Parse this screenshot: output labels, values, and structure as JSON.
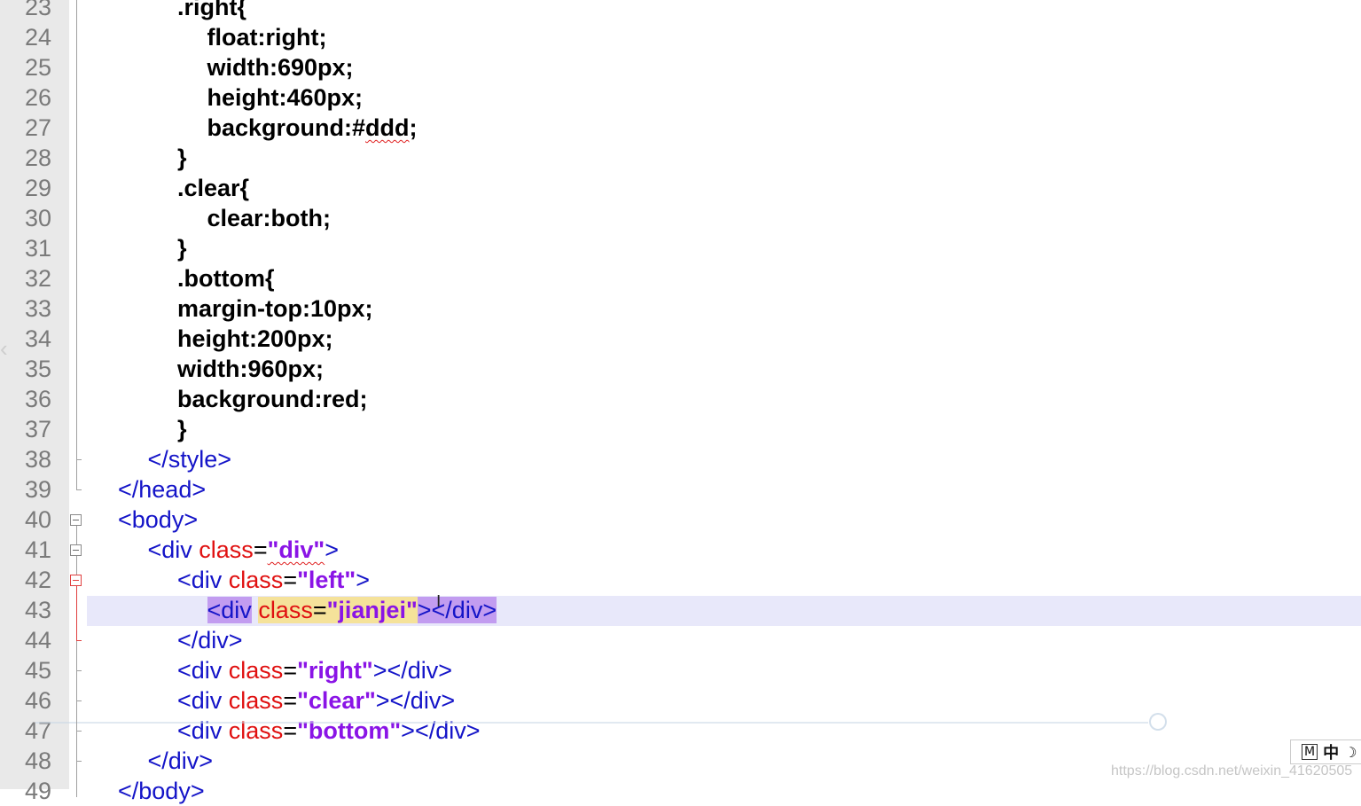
{
  "editor": {
    "lines": [
      {
        "n": "23",
        "indent": 6,
        "tokens": [
          {
            "t": "css",
            "v": ".right{"
          }
        ]
      },
      {
        "n": "24",
        "indent": 7,
        "tokens": [
          {
            "t": "css",
            "v": "float:right;"
          }
        ]
      },
      {
        "n": "25",
        "indent": 7,
        "tokens": [
          {
            "t": "css",
            "v": "width:690px;"
          }
        ]
      },
      {
        "n": "26",
        "indent": 7,
        "tokens": [
          {
            "t": "css",
            "v": "height:460px;"
          }
        ]
      },
      {
        "n": "27",
        "indent": 7,
        "tokens": [
          {
            "t": "css",
            "v": "background:#"
          },
          {
            "t": "css",
            "v": "ddd",
            "squig": true
          },
          {
            "t": "css",
            "v": ";"
          }
        ]
      },
      {
        "n": "28",
        "indent": 6,
        "tokens": [
          {
            "t": "css",
            "v": "}"
          }
        ]
      },
      {
        "n": "29",
        "indent": 6,
        "tokens": [
          {
            "t": "css",
            "v": ".clear{"
          }
        ]
      },
      {
        "n": "30",
        "indent": 7,
        "tokens": [
          {
            "t": "css",
            "v": "clear:both;"
          }
        ]
      },
      {
        "n": "31",
        "indent": 6,
        "tokens": [
          {
            "t": "css",
            "v": "}"
          }
        ]
      },
      {
        "n": "32",
        "indent": 6,
        "tokens": [
          {
            "t": "css",
            "v": ".bottom{"
          }
        ]
      },
      {
        "n": "33",
        "indent": 6,
        "tokens": [
          {
            "t": "css",
            "v": "margin-top:10px;"
          }
        ]
      },
      {
        "n": "34",
        "indent": 6,
        "tokens": [
          {
            "t": "css",
            "v": "height:200px;"
          }
        ]
      },
      {
        "n": "35",
        "indent": 6,
        "tokens": [
          {
            "t": "css",
            "v": "width:960px;"
          }
        ]
      },
      {
        "n": "36",
        "indent": 6,
        "tokens": [
          {
            "t": "css",
            "v": "background:red;"
          }
        ]
      },
      {
        "n": "37",
        "indent": 6,
        "tokens": [
          {
            "t": "css",
            "v": "}"
          }
        ]
      },
      {
        "n": "38",
        "indent": 5,
        "tokens": [
          {
            "t": "tag",
            "v": "</style>"
          }
        ]
      },
      {
        "n": "39",
        "indent": 4,
        "tokens": [
          {
            "t": "tag",
            "v": "</head>"
          }
        ]
      },
      {
        "n": "40",
        "indent": 4,
        "tokens": [
          {
            "t": "tag",
            "v": "<body>"
          }
        ]
      },
      {
        "n": "41",
        "indent": 5,
        "tokens": [
          {
            "t": "tag",
            "v": "<div "
          },
          {
            "t": "attr",
            "v": "class"
          },
          {
            "t": "eq",
            "v": "="
          },
          {
            "t": "val",
            "v": "\"div\"",
            "squig": true
          },
          {
            "t": "tag",
            "v": ">"
          }
        ]
      },
      {
        "n": "42",
        "indent": 6,
        "tokens": [
          {
            "t": "tag",
            "v": "<div "
          },
          {
            "t": "attr",
            "v": "class"
          },
          {
            "t": "eq",
            "v": "="
          },
          {
            "t": "val",
            "v": "\"left\""
          },
          {
            "t": "tag",
            "v": ">"
          }
        ]
      },
      {
        "n": "43",
        "indent": 7,
        "current": true,
        "tokens": [
          {
            "t": "tag",
            "v": "<div",
            "hl": "tag"
          },
          {
            "t": "tag",
            "v": " "
          },
          {
            "t": "attr",
            "v": "class",
            "hl": "attr"
          },
          {
            "t": "eq",
            "v": "=",
            "hl": "attr"
          },
          {
            "t": "val",
            "v": "\"jianjei",
            "hl": "attr"
          },
          {
            "t": "val",
            "v": "\"",
            "hl": "attr",
            "caret": true
          },
          {
            "t": "tag",
            "v": "></div>",
            "hl": "tag"
          }
        ]
      },
      {
        "n": "44",
        "indent": 6,
        "tokens": [
          {
            "t": "tag",
            "v": "</div>"
          }
        ]
      },
      {
        "n": "45",
        "indent": 6,
        "tokens": [
          {
            "t": "tag",
            "v": "<div "
          },
          {
            "t": "attr",
            "v": "class"
          },
          {
            "t": "eq",
            "v": "="
          },
          {
            "t": "val",
            "v": "\"right\""
          },
          {
            "t": "tag",
            "v": "></div>"
          }
        ]
      },
      {
        "n": "46",
        "indent": 6,
        "tokens": [
          {
            "t": "tag",
            "v": "<div "
          },
          {
            "t": "attr",
            "v": "class"
          },
          {
            "t": "eq",
            "v": "="
          },
          {
            "t": "val",
            "v": "\"clear\""
          },
          {
            "t": "tag",
            "v": "></div>"
          }
        ]
      },
      {
        "n": "47",
        "indent": 6,
        "tokens": [
          {
            "t": "tag",
            "v": "<div "
          },
          {
            "t": "attr",
            "v": "class"
          },
          {
            "t": "eq",
            "v": "="
          },
          {
            "t": "val",
            "v": "\"bottom\""
          },
          {
            "t": "tag",
            "v": "></div>"
          }
        ]
      },
      {
        "n": "48",
        "indent": 5,
        "tokens": [
          {
            "t": "tag",
            "v": "</div>"
          }
        ]
      },
      {
        "n": "49",
        "indent": 4,
        "tokens": [
          {
            "t": "tag",
            "v": "</body>"
          }
        ]
      }
    ],
    "colors": {
      "css_text": "#000000",
      "tag": "#1414c8",
      "attribute": "#e01010",
      "value": "#8a14e6",
      "current_line": "#e8e8fa",
      "gutter": "#e9e9e9",
      "line_number": "#7a7a7a"
    }
  },
  "ime_indicator": {
    "mode": "M",
    "lang": "中",
    "icon": "moon-icon",
    "icon_glyph": "☽"
  },
  "watermark": "https://blog.csdn.net/weixin_41620505",
  "overlay": {
    "icons": [
      "left-arrow-icon"
    ],
    "left_arrow_glyph": "‹"
  }
}
